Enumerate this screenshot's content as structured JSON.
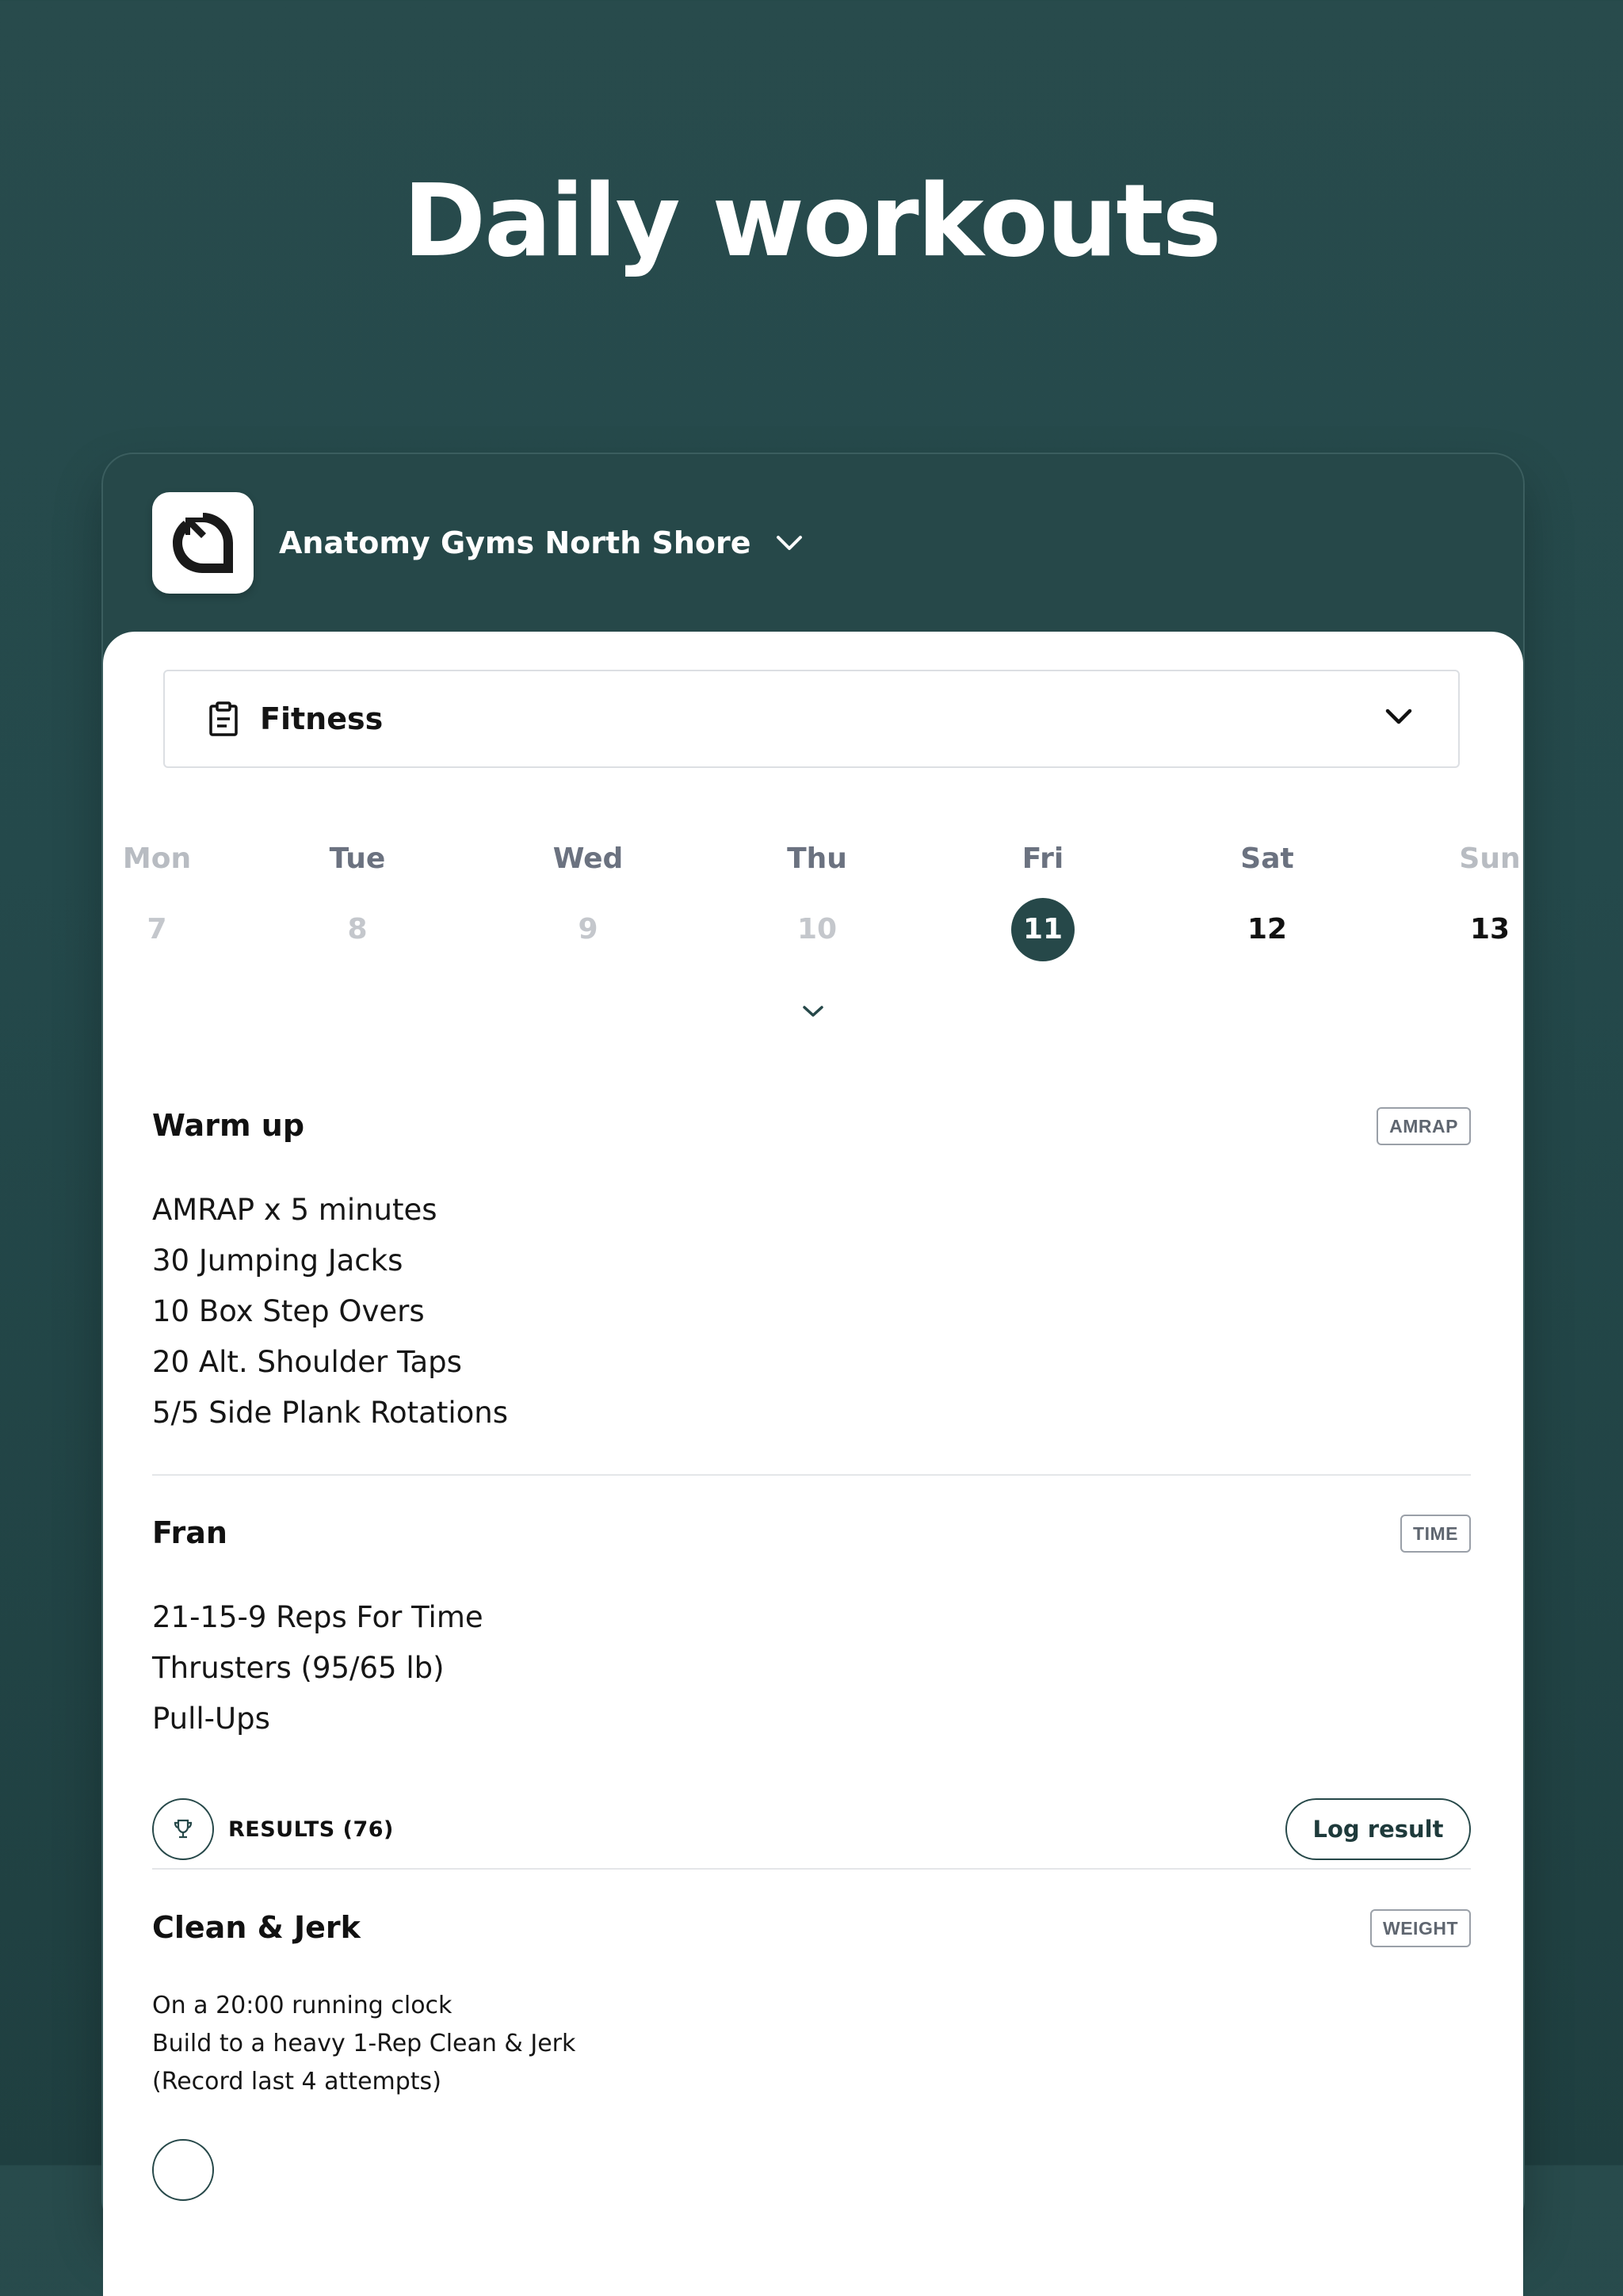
{
  "headline": "Daily workouts",
  "gym": {
    "name": "Anatomy Gyms North Shore",
    "logo_icon": "gym-logo-icon"
  },
  "program": {
    "label": "Fitness",
    "icon": "clipboard-icon"
  },
  "week": {
    "days": [
      {
        "name": "Mon",
        "num": "7"
      },
      {
        "name": "Tue",
        "num": "8"
      },
      {
        "name": "Wed",
        "num": "9"
      },
      {
        "name": "Thu",
        "num": "10"
      },
      {
        "name": "Fri",
        "num": "11"
      },
      {
        "name": "Sat",
        "num": "12"
      },
      {
        "name": "Sun",
        "num": "13"
      }
    ],
    "selected_day": "Fri"
  },
  "workouts": [
    {
      "title": "Warm up",
      "tag": "AMRAP",
      "lines": [
        "AMRAP x 5 minutes",
        "30 Jumping Jacks",
        "10 Box Step Overs",
        "20 Alt. Shoulder Taps",
        "5/5 Side Plank Rotations"
      ]
    },
    {
      "title": "Fran",
      "tag": "TIME",
      "lines": [
        "21-15-9 Reps For Time",
        "Thrusters (95/65 lb)",
        "Pull-Ups"
      ],
      "results_label": "RESULTS (76)",
      "log_label": "Log result"
    },
    {
      "title": "Clean & Jerk",
      "tag": "WEIGHT",
      "lines": [
        "On a 20:00 running clock",
        "Build to a heavy 1-Rep Clean & Jerk",
        "(Record last 4 attempts)"
      ]
    }
  ],
  "colors": {
    "brand": "#264849",
    "background": "#284b4c",
    "muted_text": "#6b7280"
  }
}
